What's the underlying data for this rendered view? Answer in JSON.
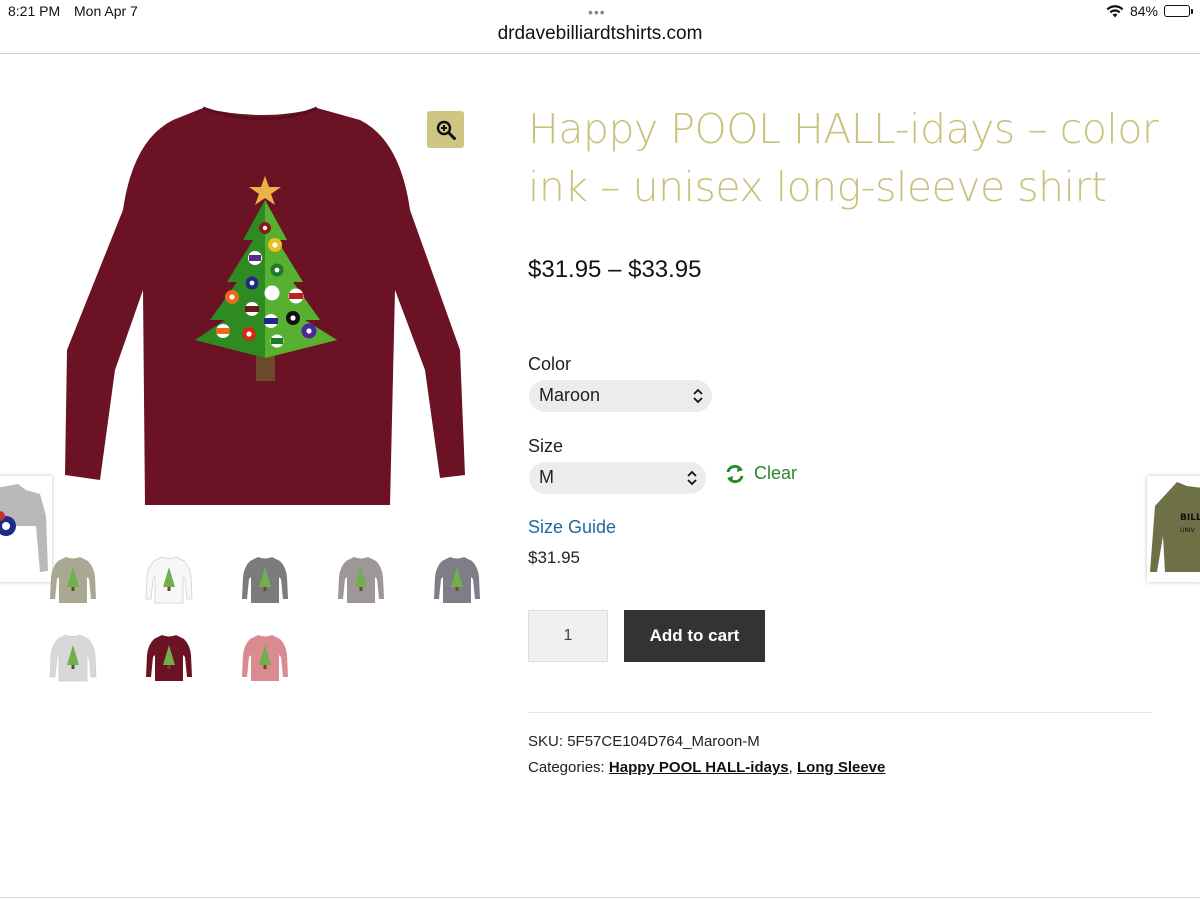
{
  "status": {
    "time": "8:21 PM",
    "date": "Mon Apr 7",
    "battery": "84%",
    "battery_level": 0.84
  },
  "browser": {
    "url": "drdavebilliardtshirts.com"
  },
  "product": {
    "title": "Happy POOL HALL-idays – color ink – unisex long-sleeve shirt",
    "price_range": "$31.95 – $33.95",
    "color_label": "Color",
    "color_value": "Maroon",
    "size_label": "Size",
    "size_value": "M",
    "clear_label": "Clear",
    "size_guide": "Size Guide",
    "variation_price": "$31.95",
    "quantity": "1",
    "add_to_cart": "Add to cart",
    "sku_label": "SKU:",
    "sku_value": "5F57CE104D764_Maroon-M",
    "categories_label": "Categories:",
    "categories": [
      "Happy POOL HALL-idays",
      "Long Sleeve"
    ],
    "category_separator": ","
  },
  "gallery": {
    "thumb_colors": [
      "#a8a893",
      "#f7f7f7",
      "#7b7b7b",
      "#9d9797",
      "#7f7d87",
      "#d8d8d8",
      "#6b1224",
      "#d98b8f"
    ],
    "main_color": "#6b1224",
    "prev_product_color": "#b8b8b8",
    "next_product_color": "#6e7046"
  },
  "colors": {
    "accent_title": "#c9c27f",
    "link": "#1e6a9c",
    "clear_green": "#2a8a2a",
    "button_dark": "#333333"
  }
}
